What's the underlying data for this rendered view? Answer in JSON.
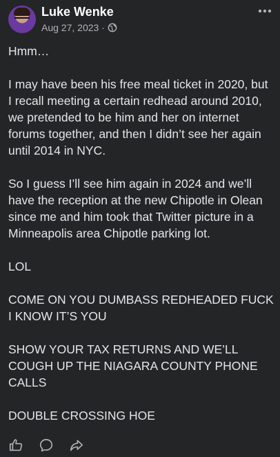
{
  "post": {
    "author": "Luke Wenke",
    "date": "Aug 27, 2023",
    "separator": "·",
    "audience_icon": "globe-icon",
    "paragraphs": [
      "Hmm…",
      "I may have been his free meal ticket in 2020, but I recall meeting a certain redhead around 2010, we pretended to be him and her on internet forums together, and then I didn’t see her again until 2014 in NYC.",
      "So I guess I’ll see him again in 2024 and we’ll have the reception at the new Chipotle in Olean since me and him took that Twitter picture in a Minneapolis area Chipotle parking lot.",
      "LOL",
      "COME ON YOU DUMBASS REDHEADED FUCK I KNOW IT’S YOU",
      "SHOW YOUR TAX RETURNS AND WE’LL COUGH UP THE NIAGARA COUNTY PHONE CALLS",
      "DOUBLE CROSSING HOE"
    ]
  },
  "actions": {
    "icons": [
      "thumbs-up-icon",
      "comment-icon",
      "share-icon"
    ]
  },
  "menu_icon": "more-options-icon",
  "colors": {
    "background": "#242526",
    "primary_text": "#e4e6eb",
    "secondary_text": "#b0b3b8"
  }
}
